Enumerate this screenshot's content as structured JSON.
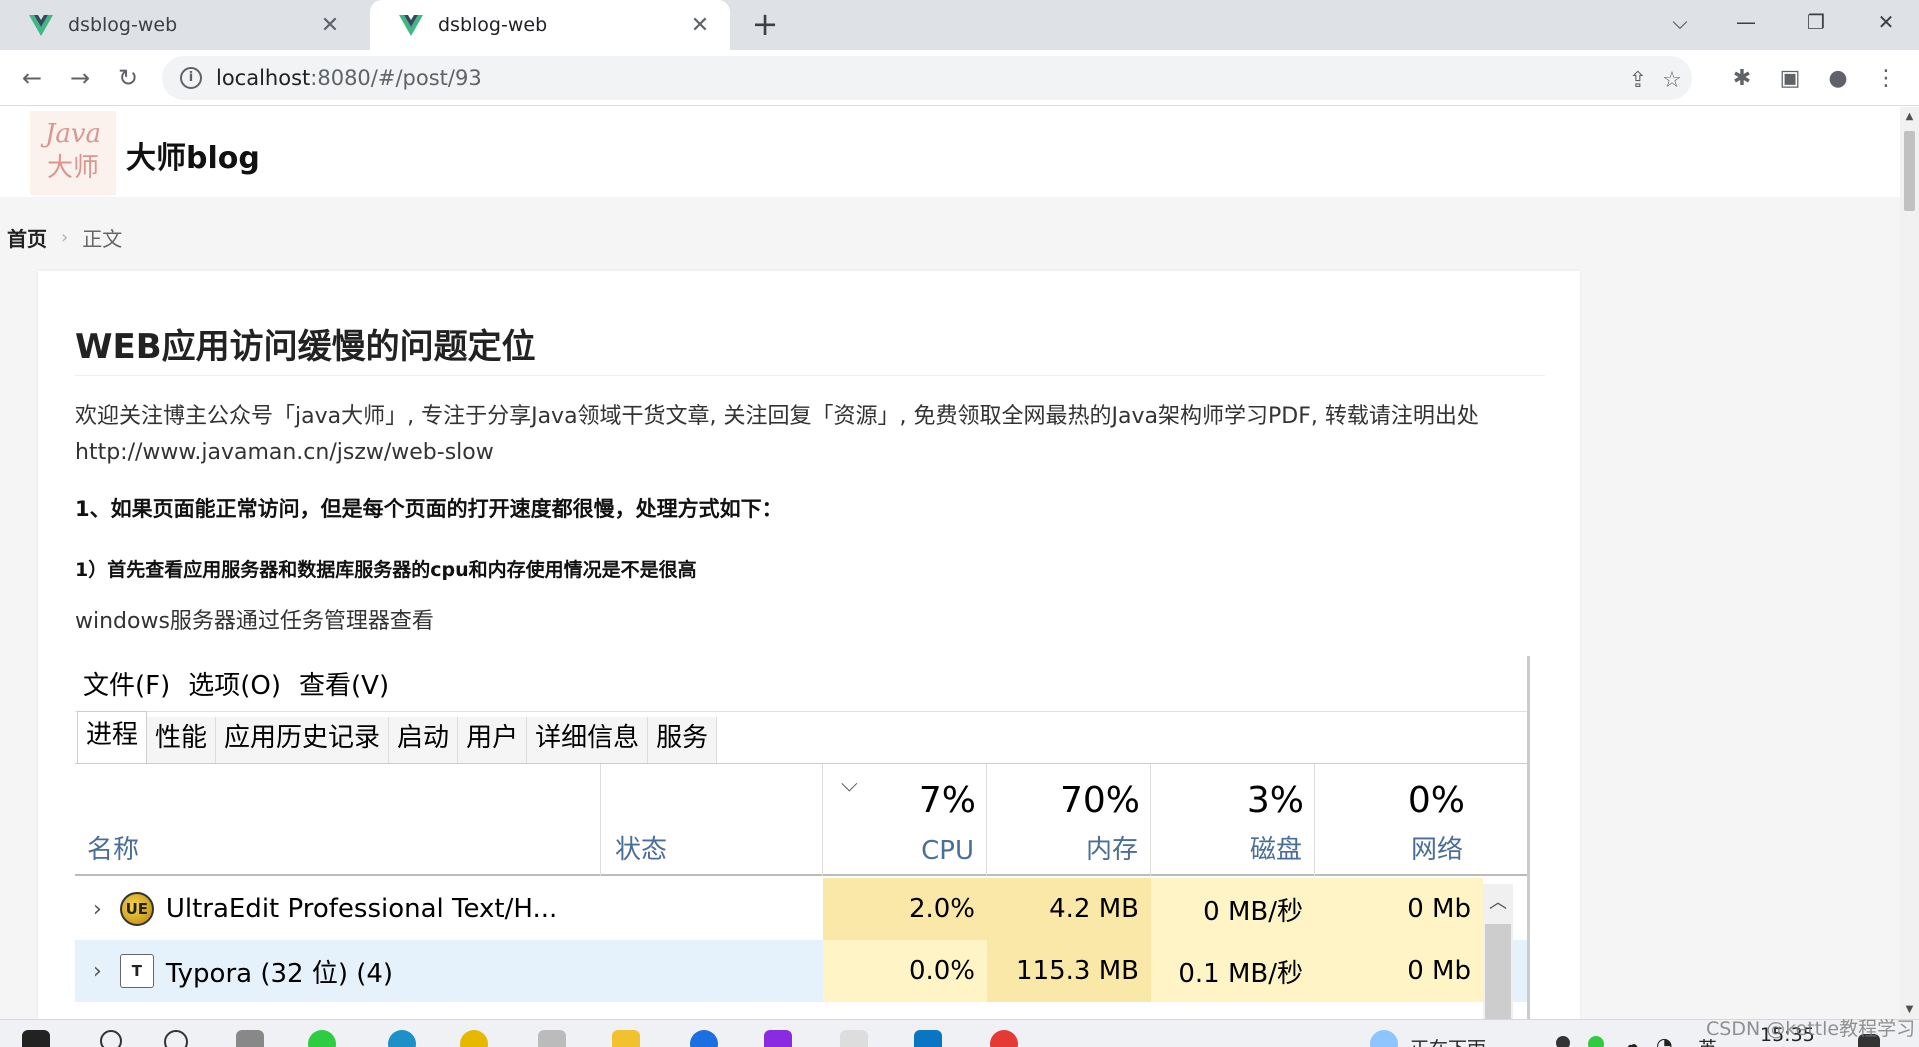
{
  "browser": {
    "tabs": [
      {
        "title": "dsblog-web",
        "active": false
      },
      {
        "title": "dsblog-web",
        "active": true
      }
    ],
    "new_tab_label": "+",
    "url_host": "localhost",
    "url_path": ":8080/#/post/93"
  },
  "site": {
    "logo_line1": "Java",
    "logo_line2": "大师",
    "name": "大师blog"
  },
  "breadcrumb": {
    "home": "首页",
    "current": "正文"
  },
  "article": {
    "title": "WEB应用访问缓慢的问题定位",
    "intro": "欢迎关注博主公众号「java大师」, 专注于分享Java领域干货文章, 关注回复「资源」, 免费领取全网最热的Java架构师学习PDF, 转载请注明出处 http://www.javaman.cn/jszw/web-slow",
    "heading1": "1、如果页面能正常访问，但是每个页面的打开速度都很慢，处理方式如下：",
    "heading2": "1）首先查看应用服务器和数据库服务器的cpu和内存使用情况是不是很高",
    "paragraph": "windows服务器通过任务管理器查看"
  },
  "task_manager": {
    "menu": [
      "文件(F)",
      "选项(O)",
      "查看(V)"
    ],
    "tabs": [
      "进程",
      "性能",
      "应用历史记录",
      "启动",
      "用户",
      "详细信息",
      "服务"
    ],
    "columns": {
      "name": "名称",
      "status": "状态",
      "cpu_pct": "7%",
      "cpu": "CPU",
      "mem_pct": "70%",
      "mem": "内存",
      "disk_pct": "3%",
      "disk": "磁盘",
      "net_pct": "0%",
      "net": "网络"
    },
    "rows": [
      {
        "name": "UltraEdit Professional Text/H...",
        "cpu": "2.0%",
        "mem": "4.2 MB",
        "disk": "0 MB/秒",
        "net": "0 Mb"
      },
      {
        "name": "Typora (32 位) (4)",
        "cpu": "0.0%",
        "mem": "115.3 MB",
        "disk": "0.1 MB/秒",
        "net": "0 Mb"
      }
    ]
  },
  "taskbar": {
    "status_text": "正在下雨",
    "ime": "英",
    "clock": "15:35"
  },
  "watermark": "CSDN @kettle教程学习",
  "colors": {
    "accent_vue_green": "#41b883",
    "tm_header_blue": "#4a6e9a",
    "heat_high": "#f9e8a8",
    "heat_low": "#fff4c6"
  }
}
